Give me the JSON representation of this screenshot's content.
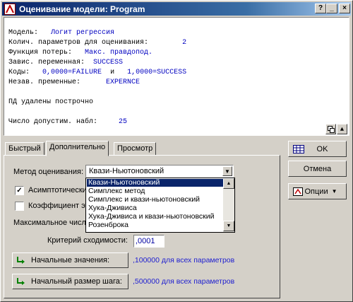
{
  "window": {
    "title": "Оценивание модели: Program",
    "title_buttons": [
      "?",
      "_",
      "×"
    ]
  },
  "output": {
    "lines": [
      {
        "label": "Модель:",
        "value": "Логит регрессия"
      },
      {
        "label": "Колич. параметров для оценивания:",
        "value": "2"
      },
      {
        "label": "Функция потерь:",
        "value": "Макс. правдопод."
      },
      {
        "label": "Завис. переменная:",
        "value": "SUCCESS"
      },
      {
        "label": "Коды:",
        "value": "0,0000=FAILURE",
        "mid": "и",
        "value2": "1,0000=SUCCESS"
      },
      {
        "label": "Незав. пременные:",
        "value": "EXPERNCE"
      },
      {
        "label": "ПД удалены построчно"
      },
      {
        "label": "Число допустим. набл:",
        "value": "25"
      }
    ]
  },
  "tabs": [
    {
      "label": "Быстрый"
    },
    {
      "label": "Дополнительно"
    },
    {
      "label": "Просмотр"
    }
  ],
  "method": {
    "label": "Метод оценивания:",
    "selected": "Квази-Ньютоновский",
    "options": [
      "Квази-Ньютоновский",
      "Симплекс метод",
      "Симплекс и квази-ньютоновский",
      "Хука-Дживиса",
      "Хука-Дживиса и квази-ньютоновский",
      "Розенброка"
    ]
  },
  "options_panel": {
    "asymptotic_label": "Асимптотические",
    "asymptotic_checked": true,
    "coef_label": "Коэффициент эта",
    "coef_checked": false,
    "max_label": "Максимальное число",
    "convergence_label": "Критерий сходимости:",
    "convergence_value": ",0001",
    "start_values_label": "Начальные значения:",
    "start_values_note": ",100000 для всех параметров",
    "step_size_label": "Начальный размер шага:",
    "step_size_note": ",500000 для всех параметров"
  },
  "right_buttons": {
    "ok": "OK",
    "cancel": "Отмена",
    "options": "Опции"
  }
}
